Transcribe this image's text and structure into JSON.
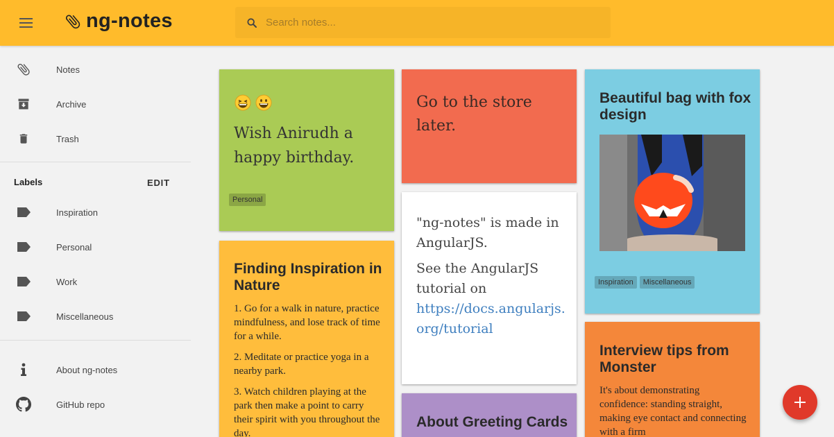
{
  "app": {
    "title": "ng-notes"
  },
  "search": {
    "placeholder": "Search notes..."
  },
  "sidebar": {
    "nav": [
      {
        "label": "Notes",
        "icon": "paperclip-icon"
      },
      {
        "label": "Archive",
        "icon": "archive-icon"
      },
      {
        "label": "Trash",
        "icon": "trash-icon"
      }
    ],
    "labels_heading": "Labels",
    "labels_edit": "EDIT",
    "labels": [
      {
        "label": "Inspiration",
        "icon": "label-icon"
      },
      {
        "label": "Personal",
        "icon": "label-icon"
      },
      {
        "label": "Work",
        "icon": "label-icon"
      },
      {
        "label": "Miscellaneous",
        "icon": "label-icon"
      }
    ],
    "footer": [
      {
        "label": "About ng-notes",
        "icon": "info-icon"
      },
      {
        "label": "GitHub repo",
        "icon": "github-icon"
      }
    ]
  },
  "notes": {
    "birthday": {
      "text": "Wish Anirudh a happy birthday.",
      "tags": [
        "Personal"
      ],
      "color": "#aacb55"
    },
    "store": {
      "text": "Go to the store later.",
      "color": "#f26b4f"
    },
    "bag": {
      "title": "Beautiful bag with fox design",
      "tags": [
        "Inspiration",
        "Miscellaneous"
      ],
      "color": "#7ccde2"
    },
    "inspiration": {
      "title": "Finding Inspiration in Nature",
      "items": [
        "1. Go for a walk in nature, practice mindfulness, and lose track of time for a while.",
        "2. Meditate or practice yoga in a nearby park.",
        "3. Watch children playing at the park then make a point to carry their spirit with you throughout the day."
      ],
      "color": "#ffbd3c"
    },
    "angular": {
      "p1": "\"ng-notes\" is made in AngularJS.",
      "p2": "See the AngularJS tutorial on",
      "link": "https://docs.angularjs.org/tutorial",
      "color": "#ffffff"
    },
    "interview": {
      "title": "Interview tips from Monster",
      "text": "It's about demonstrating confidence: standing straight, making eye contact and connecting with a firm",
      "color": "#f4873a"
    },
    "greeting": {
      "title": "About Greeting Cards",
      "color": "#ad8fc8"
    }
  },
  "fab": {
    "icon": "plus-icon"
  }
}
